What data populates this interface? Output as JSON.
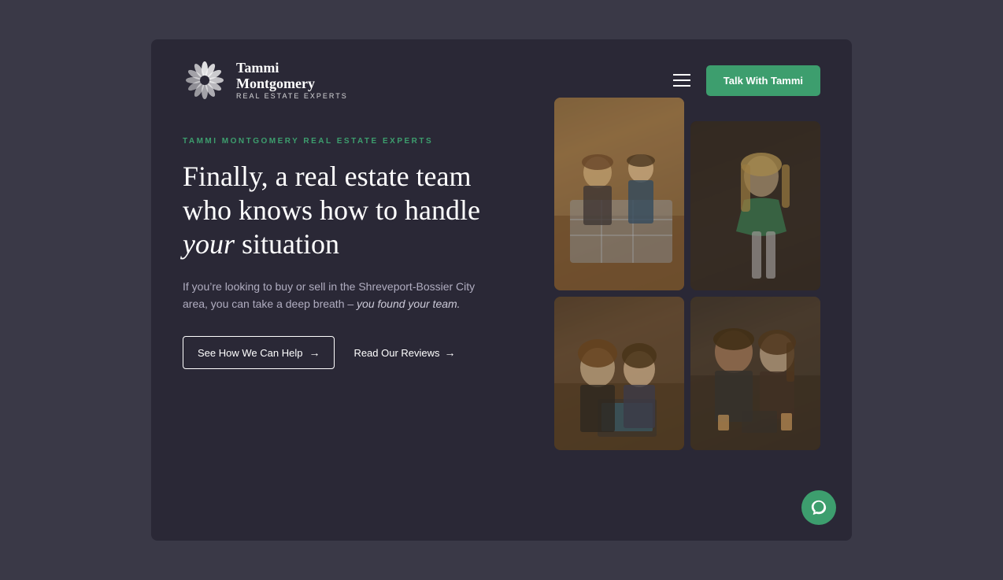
{
  "page": {
    "background_color": "#3a3947",
    "card_background": "#2a2836"
  },
  "header": {
    "logo": {
      "name_line1": "Tammi",
      "name_line2": "Montgomery",
      "subtitle": "Real Estate Experts"
    },
    "cta_button": "Talk With Tammi"
  },
  "hero": {
    "eyebrow": "Tammi Montgomery Real Estate Experts",
    "headline_part1": "Finally, a real estate team who knows how to handle ",
    "headline_italic": "your",
    "headline_part2": " situation",
    "body_part1": "If you’re looking to buy or sell in the Shreveport-Bossier City area, you can take a deep breath – ",
    "body_italic": "you found your team.",
    "primary_cta": "See How We Can Help",
    "secondary_cta": "Read Our Reviews"
  }
}
